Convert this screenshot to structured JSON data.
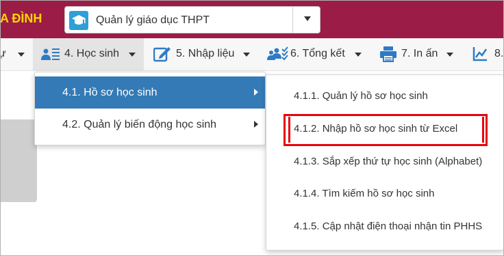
{
  "header": {
    "brand_text": "A ĐÌNH",
    "app_select": {
      "selected": "Quản lý giáo dục THPT",
      "icon": "graduation-cap-icon"
    }
  },
  "nav": {
    "items": [
      {
        "label": "ự",
        "icon": ""
      },
      {
        "label": "4. Học sinh",
        "icon": "students-list-icon"
      },
      {
        "label": "5. Nhập liệu",
        "icon": "edit-icon"
      },
      {
        "label": "6. Tổng kết",
        "icon": "group-check-icon"
      },
      {
        "label": "7. In ấn",
        "icon": "printer-icon"
      },
      {
        "label": "8.",
        "icon": "line-chart-icon"
      }
    ]
  },
  "submenu_level1": [
    {
      "label": "4.1. Hồ sơ học sinh"
    },
    {
      "label": "4.2. Quản lý biến động học sinh"
    }
  ],
  "submenu_level2": [
    {
      "label": "4.1.1. Quản lý hồ sơ học sinh"
    },
    {
      "label": "4.1.2. Nhập hồ sơ học sinh từ Excel"
    },
    {
      "label": "4.1.3. Sắp xếp thứ tự học sinh (Alphabet)"
    },
    {
      "label": "4.1.4. Tìm kiếm hồ sơ học sinh"
    },
    {
      "label": "4.1.5. Cập nhật điện thoại nhận tin PHHS"
    }
  ],
  "colors": {
    "header_bg": "#9b1c47",
    "brand_text": "#ffd400",
    "selected_item_bg": "#337ab7",
    "highlight": "#e8000c",
    "icon_blue": "#2e7bc4"
  }
}
